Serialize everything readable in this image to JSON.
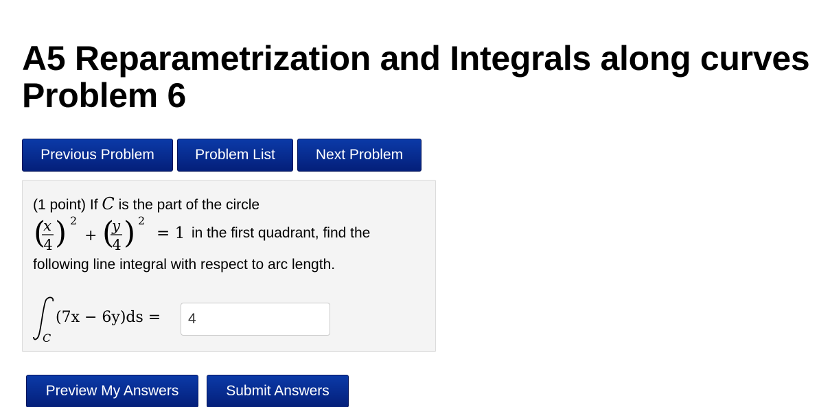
{
  "header": {
    "title_line1": "A5 Reparametrization  and Integrals along curves",
    "title_line2": "Problem 6"
  },
  "nav": {
    "previous_label": "Previous Problem",
    "list_label": "Problem List",
    "next_label": "Next Problem"
  },
  "problem": {
    "points": "(1 point) If",
    "curve_var": "C",
    "intro_rest": "is the part of the circle",
    "equation_rhs": "= 1",
    "equation_text": "in the first quadrant, find the",
    "line3": "following line integral with respect to arc length.",
    "integral_expr": "(7x − 6y)ds =",
    "integral_sub": "C"
  },
  "answer": {
    "value": "4"
  },
  "actions": {
    "preview_label": "Preview My Answers",
    "submit_label": "Submit Answers"
  },
  "colors": {
    "button": "#0a2f96",
    "panel": "#f4f4f4"
  }
}
